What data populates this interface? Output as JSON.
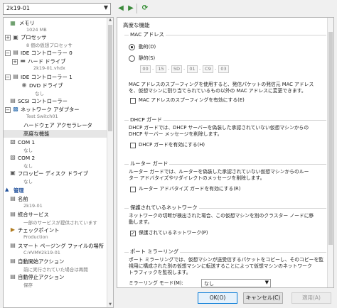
{
  "vm_selector": {
    "value": "2k19-01"
  },
  "sidebar": {
    "items": [
      {
        "label": "メモリ",
        "sub": "1024 MB"
      },
      {
        "label": "プロセッサ",
        "sub": "8 個の仮想プロセッサ"
      },
      {
        "label": "IDE コントローラー 0"
      },
      {
        "label": "ハード ドライブ",
        "sub": "2k19-01.vhdx"
      },
      {
        "label": "IDE コントローラー 1"
      },
      {
        "label": "DVD ドライブ",
        "sub": "なし"
      },
      {
        "label": "SCSI コントローラー"
      },
      {
        "label": "ネットワーク アダプター",
        "sub": "Test Switch01"
      },
      {
        "label": "ハードウェア アクセラレータ"
      },
      {
        "label": "高度な機能"
      },
      {
        "label": "COM 1",
        "sub": "なし"
      },
      {
        "label": "COM 2",
        "sub": "なし"
      },
      {
        "label": "フロッピー ディスク ドライブ",
        "sub": "なし"
      }
    ],
    "management_header": "管理",
    "management": [
      {
        "label": "名前",
        "sub": "2k19-01"
      },
      {
        "label": "統合サービス",
        "sub": "一部のサービスが提供されています"
      },
      {
        "label": "チェックポイント",
        "sub": "Production"
      },
      {
        "label": "スマート ページング ファイルの場所",
        "sub": "C:¥VM¥2k19-01"
      },
      {
        "label": "自動開始アクション",
        "sub": "前に実行されていた場合は再開"
      },
      {
        "label": "自動停止アクション",
        "sub": "保存"
      }
    ]
  },
  "main": {
    "title": "高度な機能",
    "mac": {
      "title": "MAC アドレス",
      "dynamic": "動的(D)",
      "static": "静的(S)",
      "octets": [
        "00",
        "15",
        "5D",
        "01",
        "C9",
        "03"
      ],
      "desc": [
        "MAC アドレスのスプーフィングを使用すると、発信パケットの発信元 MAC アドレス",
        "を、仮想マシンに割り当てられているもの以外の MAC アドレスに変更できます。"
      ],
      "spoof_label": "MAC アドレスのスプーフィングを有効にする(E)"
    },
    "dhcp": {
      "title": "DHCP ガード",
      "desc": [
        "DHCP ガードでは、DHCP サーバーを偽装した承認されていない仮想マシンからの",
        "DHCP サーバー メッセージを削除します。"
      ],
      "label": "DHCP ガードを有効にする(H)"
    },
    "router": {
      "title": "ルーター ガード",
      "desc": [
        "ルーター ガードでは、ルーターを偽装した承認されていない仮想マシンからのルー",
        "ター アドバタイズやリダイレクトのメッセージを削除します。"
      ],
      "label": "ルーター アドバタイズ ガードを有効にする(R)"
    },
    "protected": {
      "title": "保護されているネットワーク",
      "desc": [
        "ネットワークの切断が検出された場合、この仮想マシンを別のクラスター ノードに移",
        "動します。"
      ],
      "label": "保護されているネットワーク(P)"
    },
    "mirror": {
      "title": "ポート ミラーリング",
      "desc": [
        "ポート ミラーリングでは、仮想マシンが送受信するパケットをコピーし、そのコピーを監",
        "視用に構成された別の仮想マシンに転送することによって仮想マシンのネットワーク",
        "トラフィックを監視します。"
      ],
      "mode_label": "ミラーリング モード(M):",
      "mode_value": "なし"
    }
  },
  "footer": {
    "ok": "OK(O)",
    "cancel": "キャンセル(C)",
    "apply": "適用(A)"
  }
}
